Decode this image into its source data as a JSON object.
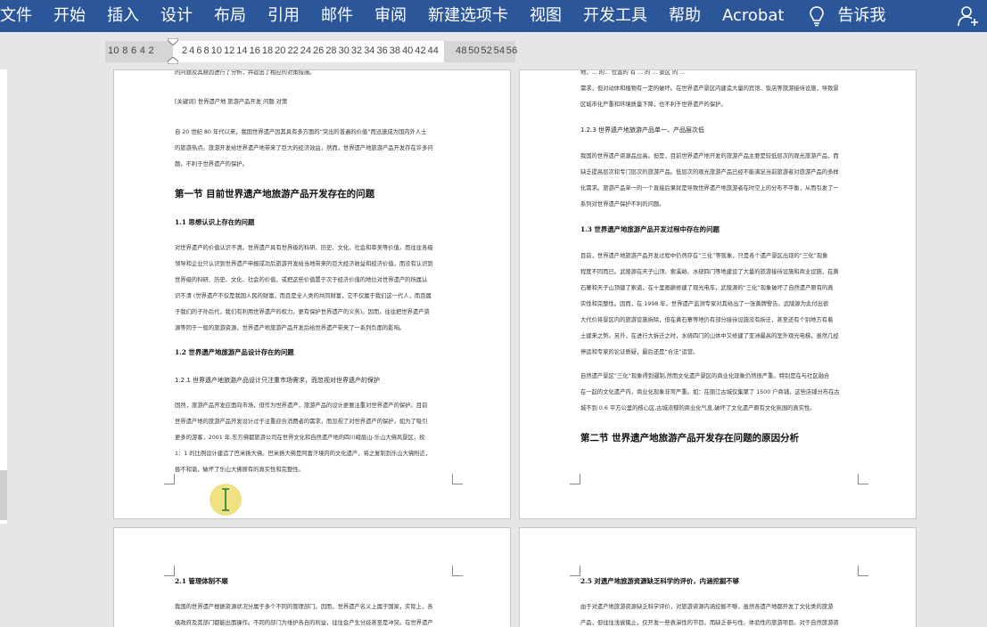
{
  "menubar": {
    "items": [
      "文件",
      "开始",
      "插入",
      "设计",
      "布局",
      "引用",
      "邮件",
      "审阅",
      "新建选项卡",
      "视图",
      "开发工具",
      "帮助",
      "Acrobat"
    ],
    "tell_me": "告诉我",
    "accent": "#2b579a"
  },
  "ruler": {
    "left_numbers": "10 8 6 4 2",
    "mid_numbers": "2 4 6 8 10 12 14 16 18 20 22 24 26 28 30 32 34 36 38 40 42 44",
    "right_numbers": "48 50 52 54 56"
  },
  "page1": {
    "line0": "的问题及其原因进行了分析，并提出了相应的对策措施。",
    "keywords": "[关键词] 世界遗产地   旅游产品开发   问题   对策",
    "intro": [
      "自 20 世纪 80 年代以来，我国世界遗产因其具有多方面的“突出的普遍的价值”而迅速成为国内外人士",
      "的旅游热点。旅游开发给世界遗产地带来了巨大的经济效益，然而，世界遗产地旅游产品开发存在许多问",
      "题，不利于世界遗产的保护。"
    ],
    "section1": "第一节     目前世界遗产地旅游产品开发存在的问题",
    "h_1_1": "1.1  思想认识上存在的问题",
    "para_1_1": [
      "对世界遗产的价值认识不清。世界遗产具有世界级的科研、历史、文化、社会和审美等价值，而往往各级",
      "领导和企业只认识到世界遗产申报成功后旅游开发给当地带来的巨大经济收益和经济价值，而没有认识到",
      "世界级的科研、历史、文化、社会的价值，或把这些价值置于次于经济价值的地位对世界遗产的所属认",
      "识不清 (世界遗产不仅是我国人民的财富，而且是全人类的共同财富，它不仅属于我们这一代人，而且属",
      "于我们的子孙后代，我们有利用世界遗产的权力，更有保护世界遗产的义务)。因而，往往把世界遗产资",
      "源等同于一般的旅游资源，世界遗产地旅游产品开发后给世界遗产带来了一系列负面的影响。"
    ],
    "h_1_2": "1.2  世界遗产地旅游产品设计存在的问题",
    "h_1_2_1": "1.2.1      世界遗产地旅游产品设计只注重市场需求，而忽视对世界遗产的保护",
    "para_1_2_1": [
      "固然，旅游产品开发应面向市场，但作为世界遗产，旅游产品的设计更要注重对世界遗产的保护。目前",
      "世界遗产地的旅游产品开发设计过于注重迎合消费者的需求，而忽视了对世界遗产的保护。如为了吸引",
      "更多的游客，2001 年,东方佛都旅游公司在世界文化和自然遗产地的四川峨眉山-乐山大佛风景区，按",
      "1：1 的比例设计建造了巴米扬大佛。巴米扬大佛是阿富汗境内的文化遗产，将之复制到乐山大佛附近，",
      "极不和谐，破坏了乐山大佛原有的真实性和完整性。"
    ]
  },
  "page2": {
    "line0": "地，... 的... 位置的 有 ... 的 ... 景区 的 ...",
    "top_lines": [
      "需求，但对动体和植物有一定的破坏。在世界遗产景区内建造大量的宾馆、饭店等旅游接待设施，导致景",
      "区城市化严重和环境质量下降，也不利于世界遗产的保护。"
    ],
    "h_1_2_3": "1.2.3      世界遗产地旅游产品单一、产品层次低",
    "para_1_2_3": [
      "我国的世界遗产资源品位高。但是，目前世界遗产地开发的旅游产品主要是较低层次的观光旅游产品，而",
      "缺乏提高层次和专门层次的旅游产品。低层次的观光旅游产品已经不能满足当前旅游者对旅游产品的多样",
      "化需求。旅游产品单一的一个直接后果就是导致世界遗产地旅游者在时空上的分布不平衡，从而引发了一",
      "系列对世界遗产保护不利的问题。"
    ],
    "h_1_3": "1.3  世界遗产地旅游产品开发过程中存在的问题",
    "para_1_3": [
      "目前，世界遗产地旅游产品开发过程中仍然存在“三化”等现象，只是各个遗产景区出现的“三化”现象",
      "程度不同而已。武陵源在天子山顶、索溪峪、水绕四门等地建设了大量的旅游接待设施和商业设施，在黄",
      "石寨和天子山顶建了索道，在十里画廊修建了观光电车，武陵源的“三化”现象破坏了自然遗产原有的真",
      "实性和完整性。因而，在 1998 年，世界遗产监测专家对其给出了一张黄牌警告。武陵源为此付出很",
      "大代价将景区内的旅游设施拆除，但在黄石寨等地仍有部分接待设施没有拆迁，甚至还有个别地方有着",
      "土建来之势。另外，在进行大拆迁之时，水绕四门的山体中又修建了亚洲最高的室外观光电梯，虽然几经",
      "停运和专家的论证质疑，最后还是“合法”运营。"
    ],
    "para_1_3b": [
      "自然遗产景区“三化”现象得到遏制,然而文化遗产景区的商业化现象仍然很严重。特别是在与社区融合",
      "在一起的文化遗产内，商业化现象非常严重。如：在丽江古城仅集聚了 1500 户商铺，这些店铺分布在古",
      "城不到 0.6 平方公里的核心区,古城浓郁的商业化气息,破坏了文化遗产原有文化氛围的真实性。"
    ],
    "section2": "第二节     世界遗产地旅游产品开发存在问题的原因分析"
  },
  "page3": {
    "h_2_1": "2.1  管理体制不顺",
    "line1": "我国的世界遗产根据资源状况分属于多个不同的管理部门。因而，世界遗产名义上属于国家，实际上，各",
    "line2": "级政府及其部门都能出面操作。不同的部门为维护各自的利益，往往会产生分歧甚至是冲突。在世界遗产"
  },
  "page4": {
    "h_2_5": "2.5  对遗产地旅游资源缺乏科学的评价，内涵挖掘不够",
    "line1": "由于对遗产地旅游资源缺乏科学评价，对旅游资源内涵挖掘不够，虽然各遗产地都开发了文化类的旅游",
    "line2": "产品，但往往浅尝辄止，仅开发一些表演性的节目，而缺乏参与性、体验性的旅游项目。对于自然旅游资"
  }
}
